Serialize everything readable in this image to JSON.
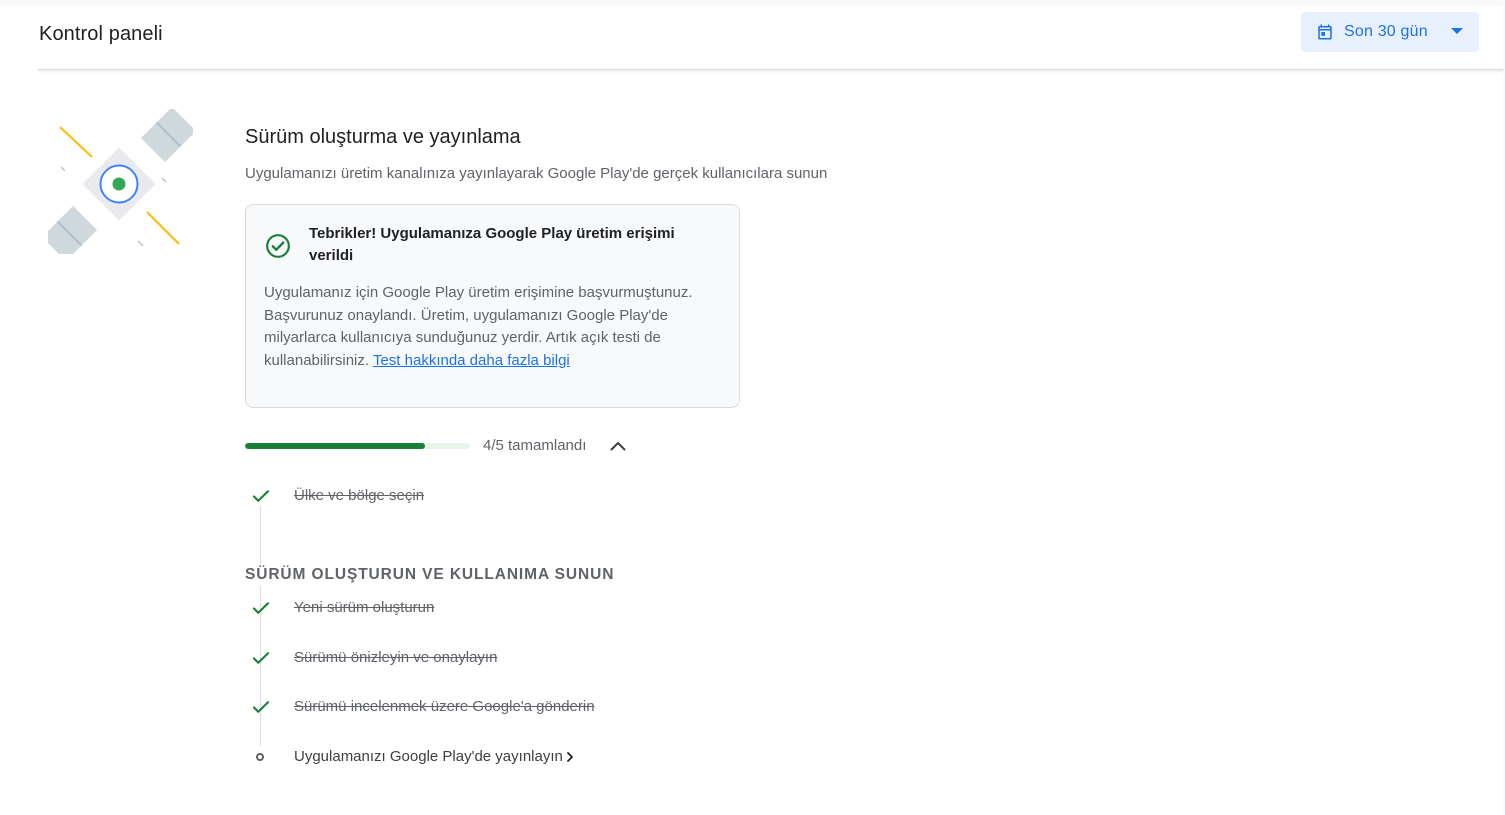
{
  "header": {
    "title": "Kontrol paneli",
    "date_range": {
      "label": "Son 30 gün",
      "icon": "calendar-icon",
      "dropdown_icon": "arrow-drop-down-icon"
    }
  },
  "section": {
    "title": "Sürüm oluşturma ve yayınlama",
    "subtitle": "Uygulamanızı üretim kanalınıza yayınlayarak Google Play'de gerçek kullanıcılara sunun",
    "illustration": "satellite-illustration"
  },
  "notice": {
    "icon": "check-circle-icon",
    "title": "Tebrikler! Uygulamanıza Google Play üretim erişimi verildi",
    "body": "Uygulamanız için Google Play üretim erişimine başvurmuştunuz. Başvurunuz onaylandı. Üretim, uygulamanızı Google Play'de milyarlarca kullanıcıya sunduğunuz yerdir. Artık açık testi de kullanabilirsiniz. ",
    "link": "Test hakkında daha fazla bilgi"
  },
  "progress": {
    "completed": 4,
    "total": 5,
    "label": "4/5 tamamlandı",
    "toggle_icon": "chevron-up-icon"
  },
  "steps_top": [
    {
      "label": "Ülke ve bölge seçin",
      "done": true
    }
  ],
  "group": {
    "heading": "SÜRÜM OLUŞTURUN VE KULLANIMA SUNUN",
    "steps": [
      {
        "label": "Yeni sürüm oluşturun",
        "done": true
      },
      {
        "label": "Sürümü önizleyin ve onaylayın",
        "done": true
      },
      {
        "label": "Sürümü incelenmek üzere Google'a gönderin",
        "done": true
      },
      {
        "label": "Uygulamanızı Google Play'de yayınlayın",
        "done": false
      }
    ]
  },
  "colors": {
    "accent": "#1a73e8",
    "success": "#188038",
    "muted_text": "#5f6368"
  }
}
